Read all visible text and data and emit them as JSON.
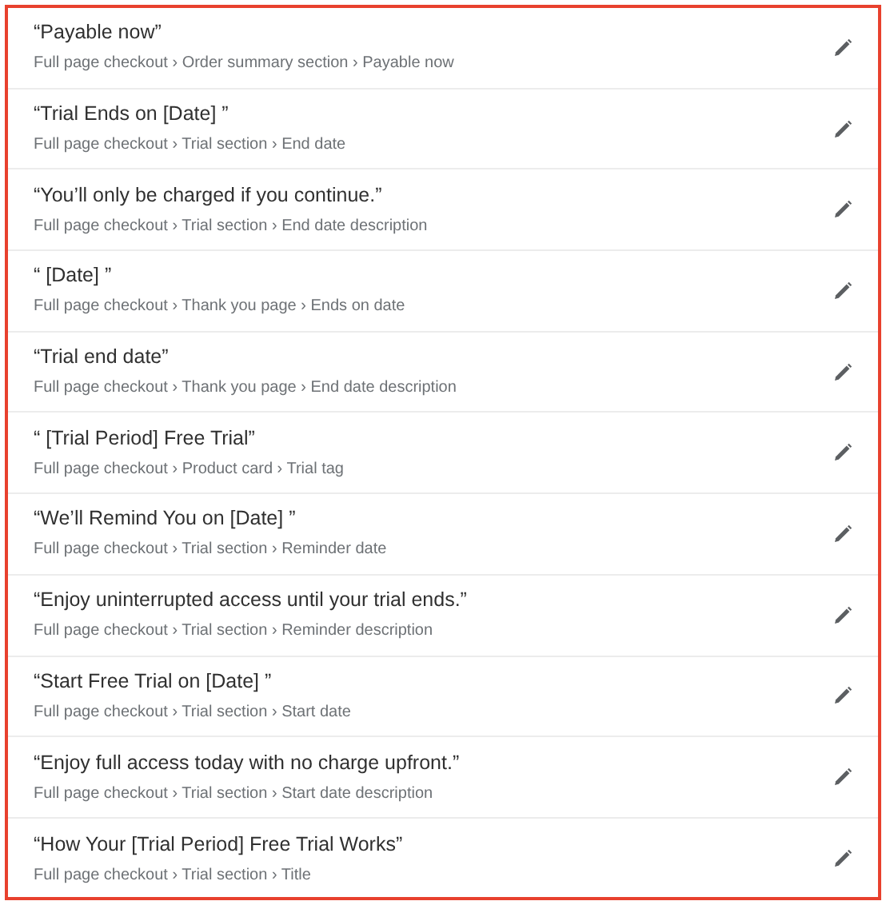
{
  "rows": [
    {
      "text": "“Payable now”",
      "path": "Full page checkout › Order summary section › Payable now"
    },
    {
      "text": "“Trial Ends on [Date] ”",
      "path": "Full page checkout › Trial section › End date"
    },
    {
      "text": "“You’ll only be charged if you continue.”",
      "path": "Full page checkout › Trial section › End date description"
    },
    {
      "text": "“ [Date] ”",
      "path": "Full page checkout › Thank you page › Ends on date"
    },
    {
      "text": "“Trial end date”",
      "path": "Full page checkout › Thank you page › End date description"
    },
    {
      "text": "“ [Trial Period] Free Trial”",
      "path": "Full page checkout › Product card › Trial tag"
    },
    {
      "text": "“We’ll Remind You on [Date] ”",
      "path": "Full page checkout › Trial section › Reminder date"
    },
    {
      "text": "“Enjoy uninterrupted access until your trial ends.”",
      "path": "Full page checkout › Trial section › Reminder description"
    },
    {
      "text": "“Start Free Trial on [Date] ”",
      "path": "Full page checkout › Trial section › Start date"
    },
    {
      "text": "“Enjoy full access today with no charge upfront.”",
      "path": "Full page checkout › Trial section › Start date description"
    },
    {
      "text": "“How Your [Trial Period] Free Trial Works”",
      "path": "Full page checkout › Trial section › Title"
    }
  ]
}
